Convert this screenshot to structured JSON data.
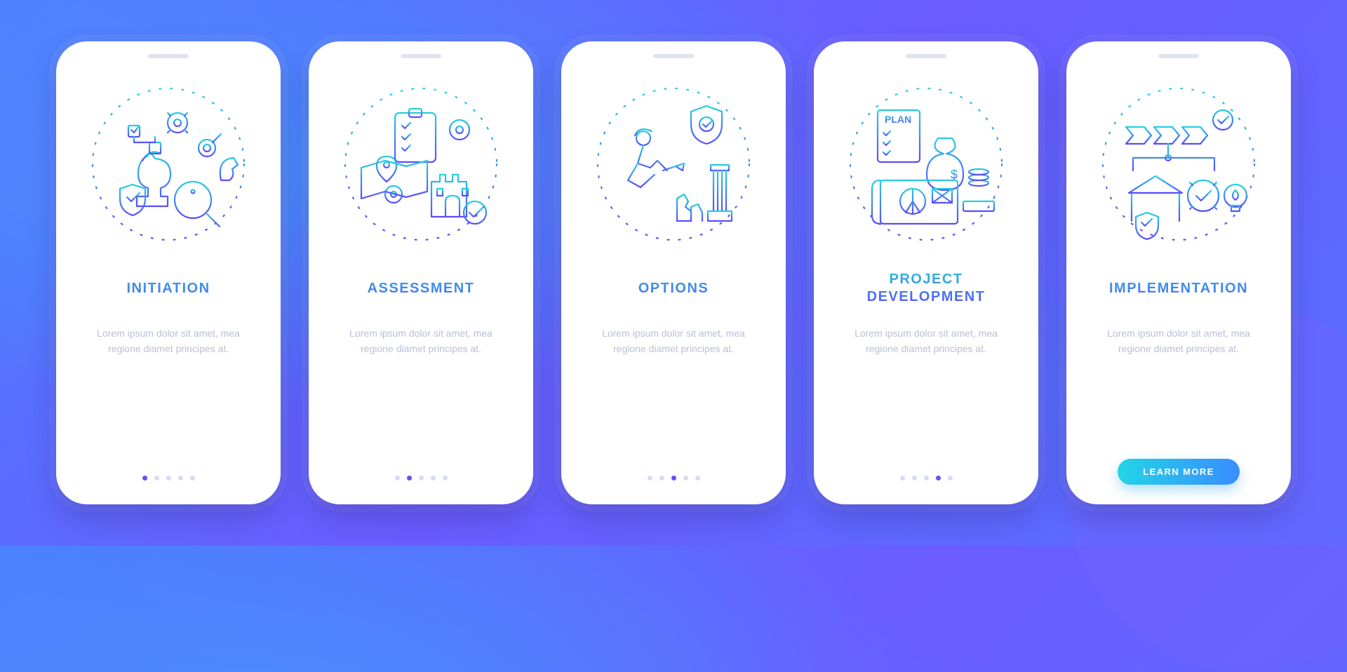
{
  "screens": [
    {
      "title": "INITIATION",
      "desc": "Lorem ipsum dolor sit amet, mea regione diamet principes at.",
      "illustration": "initiation-icon",
      "active_dot": 0
    },
    {
      "title": "ASSESSMENT",
      "desc": "Lorem ipsum dolor sit amet, mea regione diamet principes at.",
      "illustration": "assessment-icon",
      "active_dot": 1
    },
    {
      "title": "OPTIONS",
      "desc": "Lorem ipsum dolor sit amet, mea regione diamet principes at.",
      "illustration": "options-icon",
      "active_dot": 2
    },
    {
      "title": "PROJECT DEVELOPMENT",
      "desc": "Lorem ipsum dolor sit amet, mea regione diamet principes at.",
      "illustration": "project-dev-icon",
      "active_dot": 3
    },
    {
      "title": "IMPLEMENTATION",
      "desc": "Lorem ipsum dolor sit amet, mea regione diamet principes at.",
      "illustration": "implementation-icon",
      "active_dot": 4,
      "cta": "LEARN MORE"
    }
  ],
  "colors": {
    "grad_top": "#26cfe0",
    "grad_bottom": "#5b4cff",
    "dot_inactive": "#d7dcef",
    "dot_active": "#6a4cff",
    "desc_text": "#b9c0d4"
  },
  "dot_count": 5
}
